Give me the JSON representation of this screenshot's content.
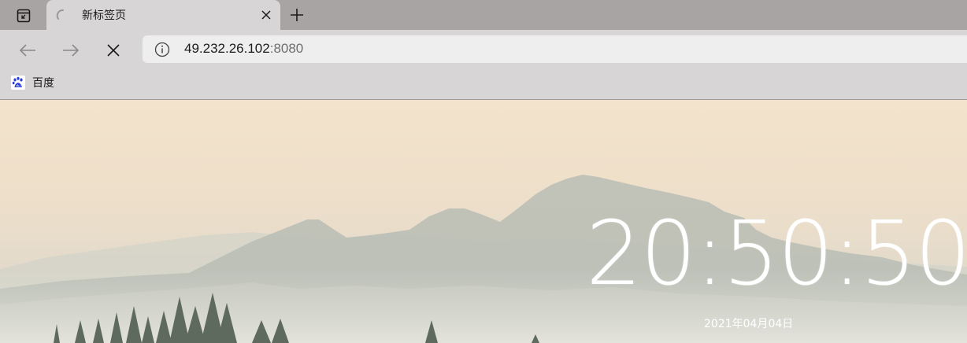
{
  "tab": {
    "title": "新标签页",
    "favicon": "loading-spinner-icon",
    "close_icon": "close-icon"
  },
  "toolbar": {
    "back_icon": "arrow-left-icon",
    "forward_icon": "arrow-right-icon",
    "stop_icon": "stop-x-icon",
    "new_tab_icon": "plus-icon",
    "tab_actions_icon": "tab-actions-icon"
  },
  "address": {
    "host": "49.232.26.102",
    "port": ":8080",
    "info_icon": "info-icon"
  },
  "bookmarks": [
    {
      "label": "百度",
      "icon": "baidu-paw-icon"
    }
  ],
  "page": {
    "time": "20:50:50",
    "date": "2021年04月04日"
  },
  "colors": {
    "tabstrip": "#a8a4a4",
    "toolbar": "#d8d5d6",
    "address_bg": "#efeeee",
    "clock": "#ffffff"
  }
}
